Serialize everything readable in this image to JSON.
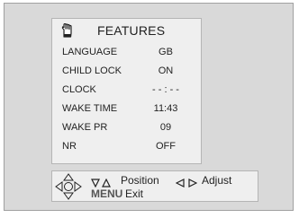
{
  "menu": {
    "title": "FEATURES",
    "title_icon": "hand-pointer-icon",
    "rows": [
      {
        "label": "LANGUAGE",
        "value": "GB"
      },
      {
        "label": "CHILD LOCK",
        "value": "ON"
      },
      {
        "label": "CLOCK",
        "value": "- - : - -"
      },
      {
        "label": "WAKE TIME",
        "value": "11:43"
      },
      {
        "label": "WAKE PR",
        "value": "09"
      },
      {
        "label": "NR",
        "value": "OFF"
      }
    ]
  },
  "help": {
    "dpad_icon": "directional-pad-icon",
    "position_label": "Position",
    "adjust_label": "Adjust",
    "menu_key": "MENU",
    "exit_label": "Exit"
  }
}
